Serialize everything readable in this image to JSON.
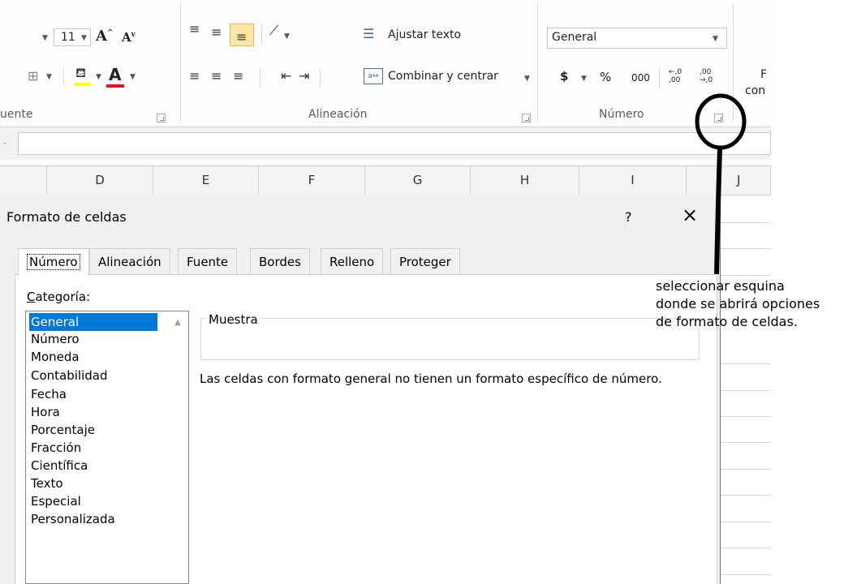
{
  "ribbon": {
    "font_group": {
      "size_value": "11",
      "label": "uente",
      "grow_icon": "A",
      "shrink_icon": "A",
      "font_color_icon": "A"
    },
    "alignment_group": {
      "wrap_text_label": "Ajustar texto",
      "merge_center_label": "Combinar y centrar",
      "label": "Alineación"
    },
    "number_group": {
      "format_value": "General",
      "currency_symbol": "$",
      "percent_symbol": "%",
      "thousands_label": "000",
      "increase_decimal": "←,0 ,00",
      "decrease_decimal": ",00 →,0",
      "label": "Número"
    },
    "cut_off_text": {
      "line1": "F",
      "line2": "con"
    }
  },
  "columns": [
    "D",
    "E",
    "F",
    "G",
    "H",
    "I",
    "J"
  ],
  "dialog": {
    "title": "Formato de celdas",
    "help_label": "?",
    "close_label": "×",
    "tabs": [
      {
        "label": "Número",
        "active": true
      },
      {
        "label": "Alineación",
        "active": false
      },
      {
        "label": "Fuente",
        "active": false
      },
      {
        "label": "Bordes",
        "active": false
      },
      {
        "label": "Relleno",
        "active": false
      },
      {
        "label": "Proteger",
        "active": false
      }
    ],
    "category_label_first": "C",
    "category_label_rest": "ategoría:",
    "categories": [
      "General",
      "Número",
      "Moneda",
      "Contabilidad",
      "Fecha",
      "Hora",
      "Porcentaje",
      "Fracción",
      "Científica",
      "Texto",
      "Especial",
      "Personalizada"
    ],
    "selected_category": "General",
    "sample_label": "Muestra",
    "description": "Las celdas con formato general no tienen un formato específico de número."
  },
  "annotation": {
    "line1": "seleccionar esquina",
    "line2": "donde se abrirá opciones",
    "line3": "de formato de celdas."
  },
  "colors": {
    "selection_blue": "#0078d7",
    "highlight_yellow": "#ffe8a6",
    "font_color_red": "#e81123"
  }
}
